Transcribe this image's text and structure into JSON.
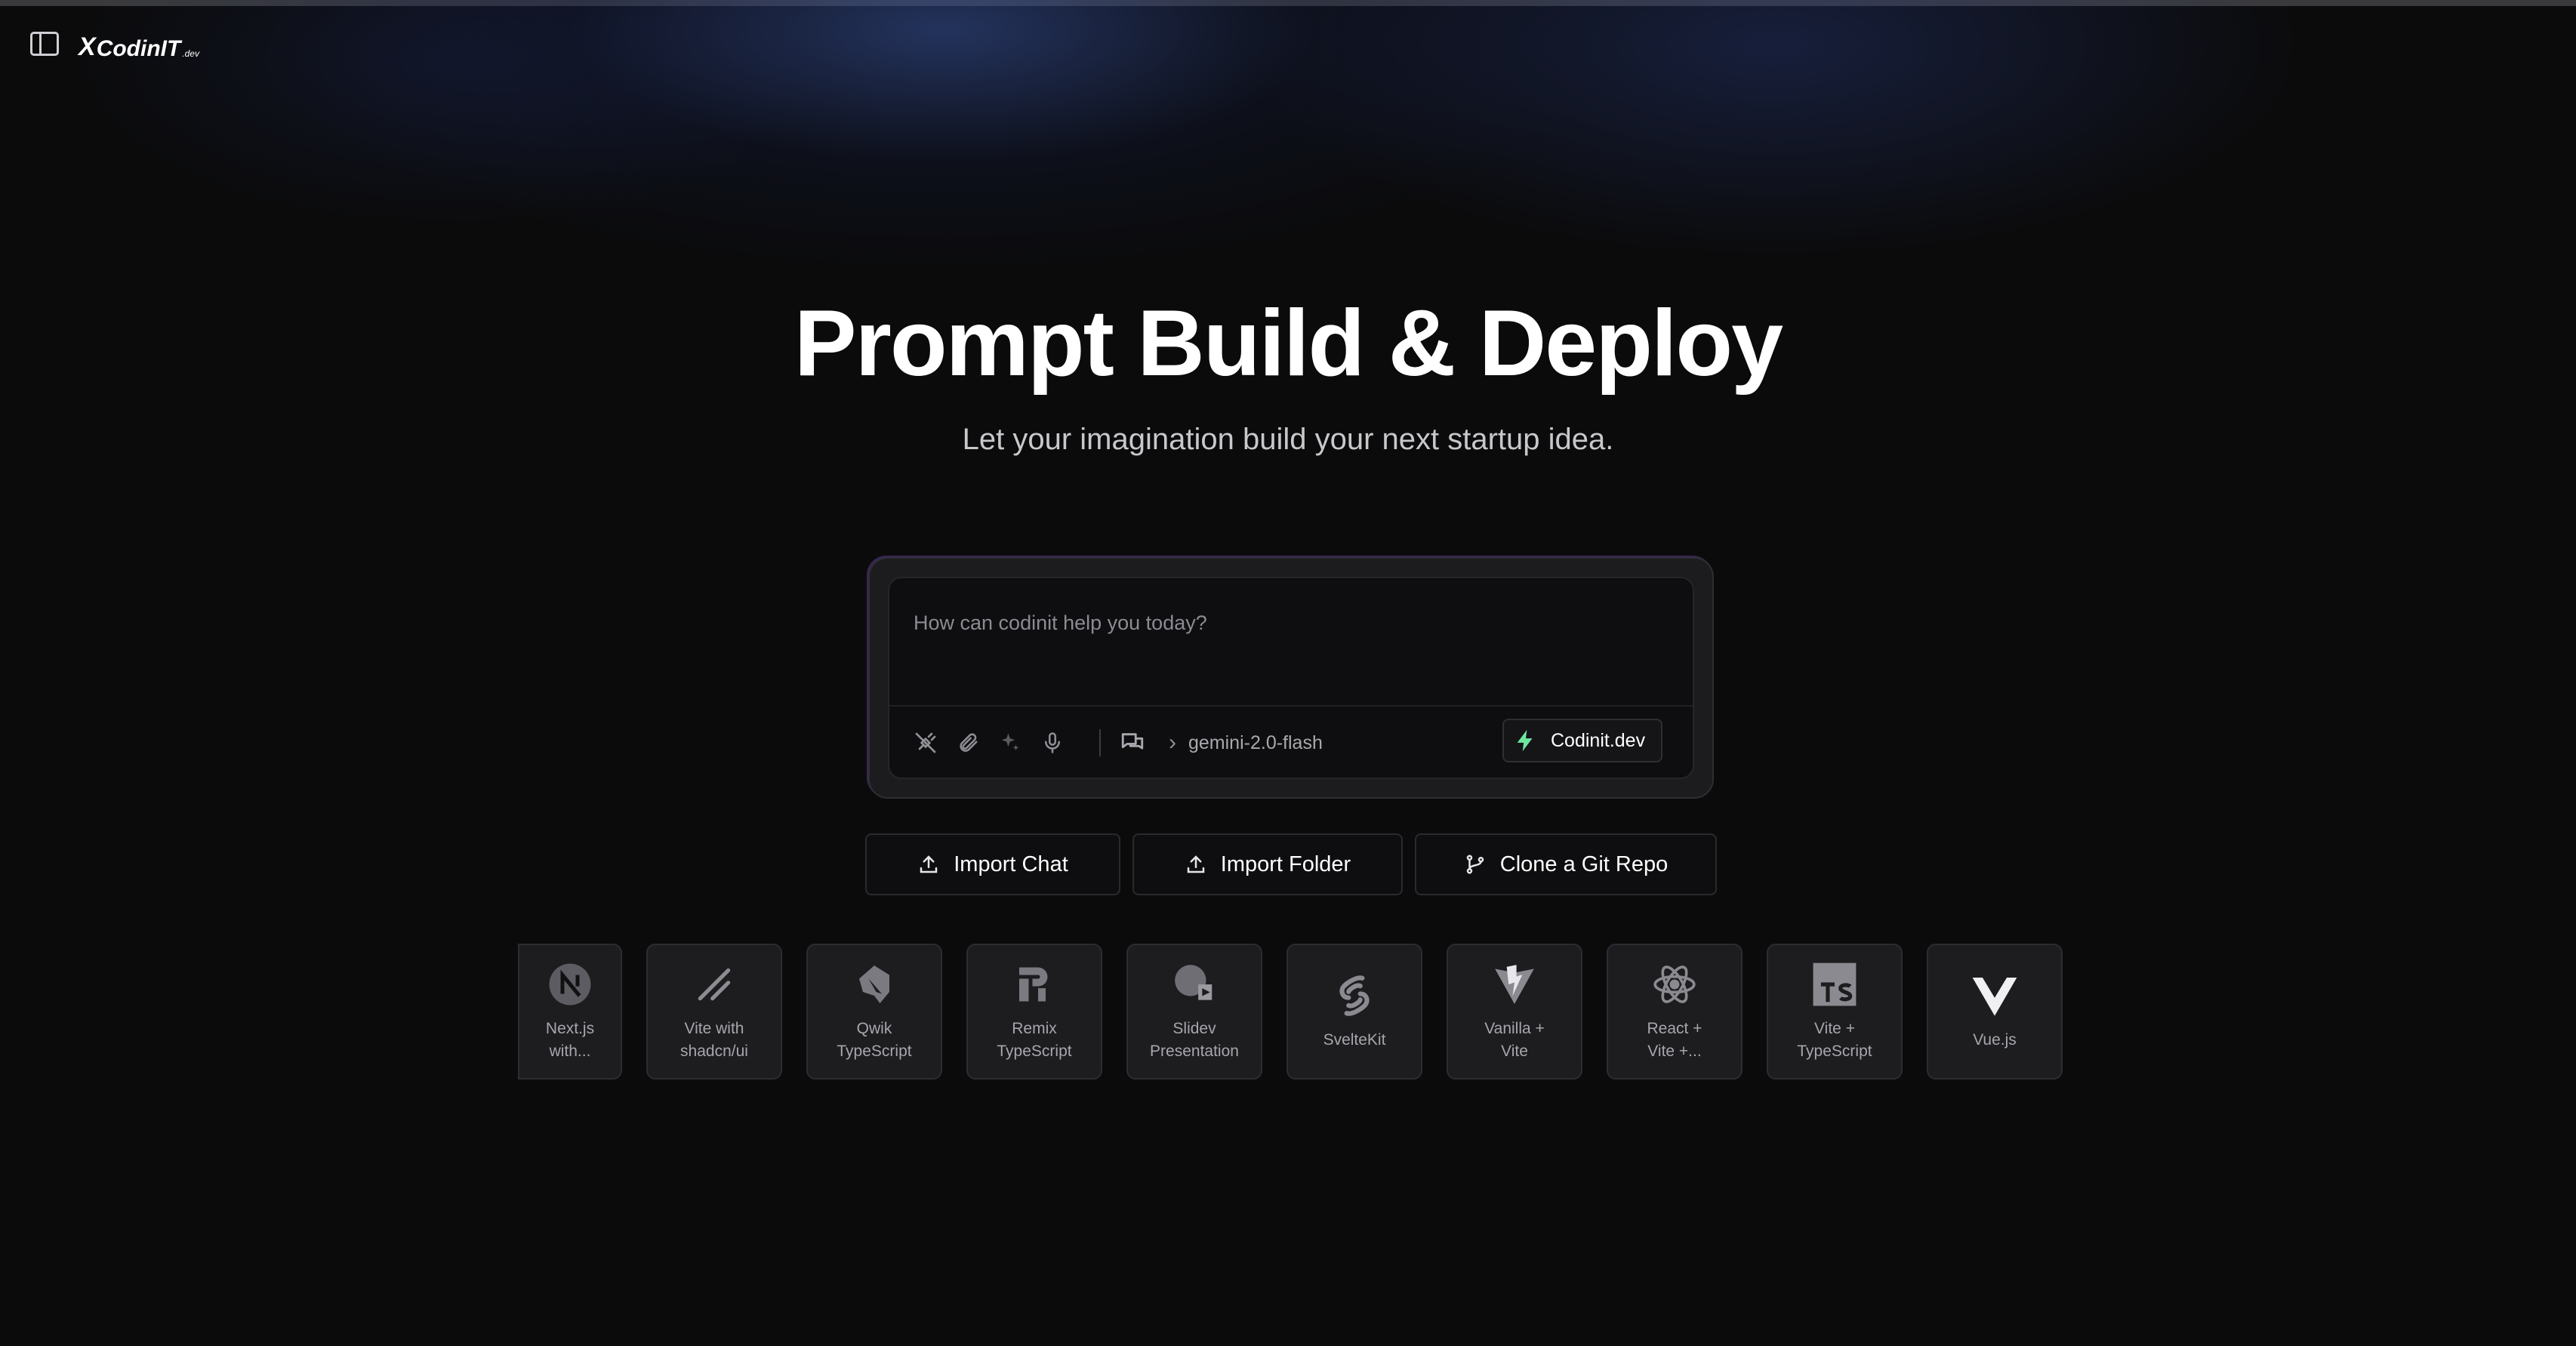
{
  "header": {
    "brand_mark": "X",
    "brand_name": "CodinIT",
    "brand_suffix": ".dev"
  },
  "hero": {
    "title": "Prompt Build & Deploy",
    "subtitle": "Let your imagination build your next startup idea."
  },
  "prompt": {
    "placeholder": "How can codinit help you today?",
    "model": "gemini-2.0-flash",
    "provider_label": "Codinit.dev",
    "accent_color": "#6ee7a0"
  },
  "actions": {
    "import_chat": "Import Chat",
    "import_folder": "Import Folder",
    "clone_repo": "Clone a Git Repo"
  },
  "templates": [
    {
      "name": "Next.js\nwith...",
      "icon": "nextjs-icon"
    },
    {
      "name": "Vite with\nshadcn/ui",
      "icon": "shadcn-icon"
    },
    {
      "name": "Qwik\nTypeScript",
      "icon": "qwik-icon"
    },
    {
      "name": "Remix\nTypeScript",
      "icon": "remix-icon"
    },
    {
      "name": "Slidev\nPresentation",
      "icon": "slidev-icon"
    },
    {
      "name": "SvelteKit",
      "icon": "svelte-icon"
    },
    {
      "name": "Vanilla +\nVite",
      "icon": "vite-icon"
    },
    {
      "name": "React +\nVite +...",
      "icon": "react-icon"
    },
    {
      "name": "Vite +\nTypeScript",
      "icon": "typescript-icon"
    },
    {
      "name": "Vue.js",
      "icon": "vue-icon"
    }
  ]
}
